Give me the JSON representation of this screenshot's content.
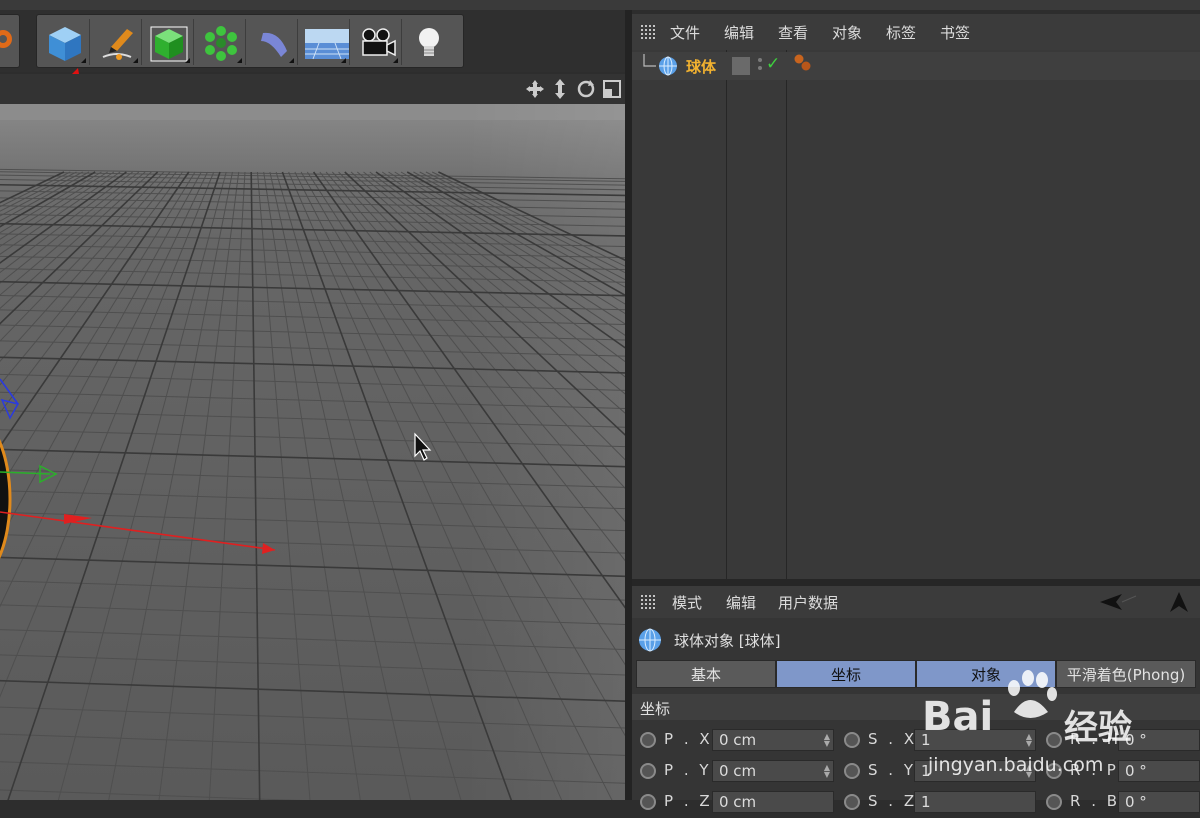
{
  "toolbar": {
    "tools": [
      {
        "name": "cube-tool",
        "icon": "cube-icon"
      },
      {
        "name": "pen-tool",
        "icon": "pen-icon"
      },
      {
        "name": "subdivision-tool",
        "icon": "green-cube-icon"
      },
      {
        "name": "cloner-tool",
        "icon": "cloner-icon"
      },
      {
        "name": "deformer-tool",
        "icon": "bend-icon"
      },
      {
        "name": "floor-tool",
        "icon": "floor-icon"
      },
      {
        "name": "camera-tool",
        "icon": "camera-icon"
      },
      {
        "name": "light-tool",
        "icon": "lightbulb-icon"
      }
    ]
  },
  "colors": {
    "accent_selected": "#e8b02a",
    "tab_active": "#7f97c9",
    "axis_x": "#e02020",
    "axis_y": "#2ab02a",
    "axis_z": "#2a3ae0",
    "arrow_annotation": "#e01010"
  },
  "object_manager": {
    "menu": [
      "文件",
      "编辑",
      "查看",
      "对象",
      "标签",
      "书签"
    ],
    "objects": [
      {
        "name": "球体",
        "selected": true,
        "visibility_icon": "checkmark-icon",
        "tag_icon": "material-spheres-icon"
      }
    ]
  },
  "attribute_manager": {
    "menu": [
      "模式",
      "编辑",
      "用户数据"
    ],
    "object_title": "球体对象 [球体]",
    "tabs": [
      {
        "label": "基本",
        "active": false
      },
      {
        "label": "坐标",
        "active": true
      },
      {
        "label": "对象",
        "active": true
      },
      {
        "label": "平滑着色(Phong)",
        "active": false
      }
    ],
    "section_title": "坐标",
    "fields": [
      {
        "label": "P . X",
        "value": "0 cm",
        "s_label": "S . X",
        "s_value": "1",
        "r_label": "R . H",
        "r_value": "0 °"
      },
      {
        "label": "P . Y",
        "value": "0 cm",
        "s_label": "S . Y",
        "s_value": "1",
        "r_label": "R . P",
        "r_value": "0 °"
      },
      {
        "label": "P . Z",
        "value": "0 cm",
        "s_label": "S . Z",
        "s_value": "1",
        "r_label": "R . B",
        "r_value": "0 °"
      }
    ]
  },
  "watermark": {
    "brand": "Bai",
    "brand_suffix": "经验",
    "url": "jingyan.baidu.com"
  }
}
